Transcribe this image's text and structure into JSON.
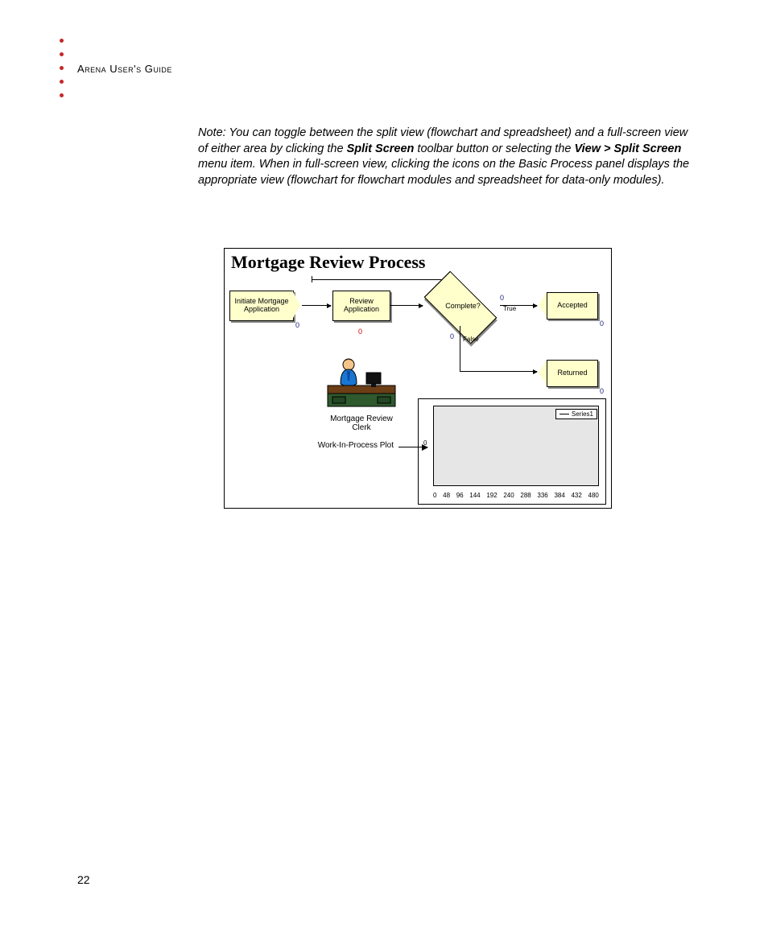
{
  "header": {
    "title": "Arena User's Guide"
  },
  "note": {
    "prefix": "Note: You can toggle between the split view (flowchart and spreadsheet) and a full-screen view of either area by clicking the ",
    "bold1": "Split Screen",
    "mid1": " toolbar button or selecting the ",
    "bold2": "View > Split Screen",
    "suffix": " menu item. When in full-screen view, clicking the icons on the Basic Process panel displays the appropriate view (flowchart for flowchart modules and spreadsheet for data-only modules)."
  },
  "figure": {
    "title": "Mortgage Review Process",
    "blocks": {
      "initiate": "Initiate Mortgage Application",
      "review": "Review Application",
      "decision": "Complete?",
      "accepted": "Accepted",
      "returned": "Returned"
    },
    "labels": {
      "true": "True",
      "false": "False",
      "clerk": "Mortgage Review Clerk",
      "wip": "Work-In-Process Plot"
    },
    "counters": {
      "initiate": "0",
      "review_red": "0",
      "decision_top": "0",
      "decision_bottom": "0",
      "accepted": "0",
      "returned": "0"
    },
    "plot": {
      "y0": "0",
      "legend": "Series1"
    }
  },
  "chart_data": {
    "type": "line",
    "title": "Work-In-Process Plot",
    "xlabel": "",
    "ylabel": "",
    "x_ticks": [
      0,
      48,
      96,
      144,
      192,
      240,
      288,
      336,
      384,
      432,
      480
    ],
    "series": [
      {
        "name": "Series1",
        "values": []
      }
    ],
    "ylim": [
      0,
      0
    ],
    "xlim": [
      0,
      480
    ]
  },
  "page_number": "22"
}
